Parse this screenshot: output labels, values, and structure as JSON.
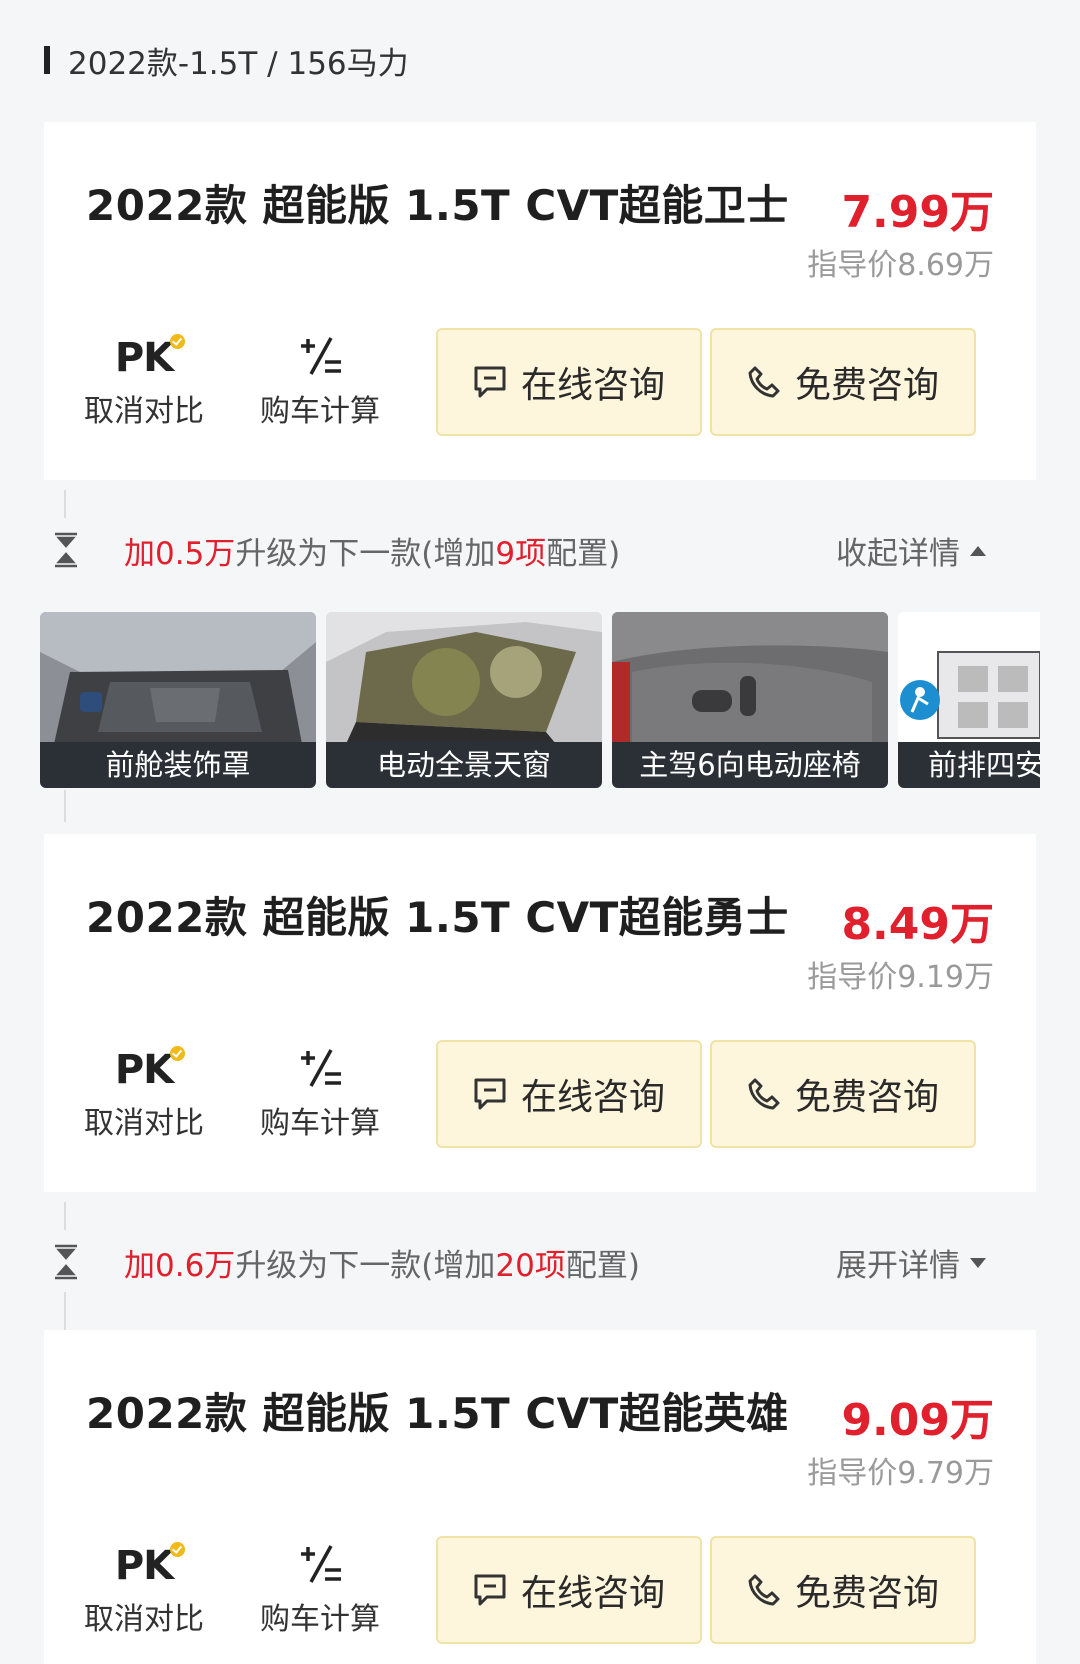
{
  "section": {
    "title": "2022款-1.5T / 156马力"
  },
  "tools": {
    "pk_label": "PK",
    "compare_label": "取消对比",
    "calc_label": "购车计算",
    "calc_icon_text": "+/="
  },
  "buttons": {
    "online": "在线咨询",
    "free": "免费咨询"
  },
  "cars": [
    {
      "title": "2022款 超能版 1.5T CVT超能卫士",
      "price": "7.99万",
      "guide": "指导价8.69万"
    },
    {
      "title": "2022款 超能版 1.5T CVT超能勇士",
      "price": "8.49万",
      "guide": "指导价9.19万"
    },
    {
      "title": "2022款 超能版 1.5T CVT超能英雄",
      "price": "9.09万",
      "guide": "指导价9.79万"
    }
  ],
  "upgrades": [
    {
      "prefix": "加",
      "amount": "0.5万",
      "middle": "升级为下一款(增加",
      "count": "9项",
      "suffix": "配置)",
      "toggle": "收起详情",
      "expanded": true
    },
    {
      "prefix": "加",
      "amount": "0.6万",
      "middle": "升级为下一款(增加",
      "count": "20项",
      "suffix": "配置)",
      "toggle": "展开详情",
      "expanded": false
    }
  ],
  "features": [
    {
      "label": "前舱装饰罩"
    },
    {
      "label": "电动全景天窗"
    },
    {
      "label": "主驾6向电动座椅"
    },
    {
      "label": "前排四安"
    }
  ],
  "colors": {
    "price_red": "#e0202c",
    "button_bg": "#fdf6dc",
    "button_border": "#f1e2a5",
    "pk_badge": "#f3b81a"
  }
}
